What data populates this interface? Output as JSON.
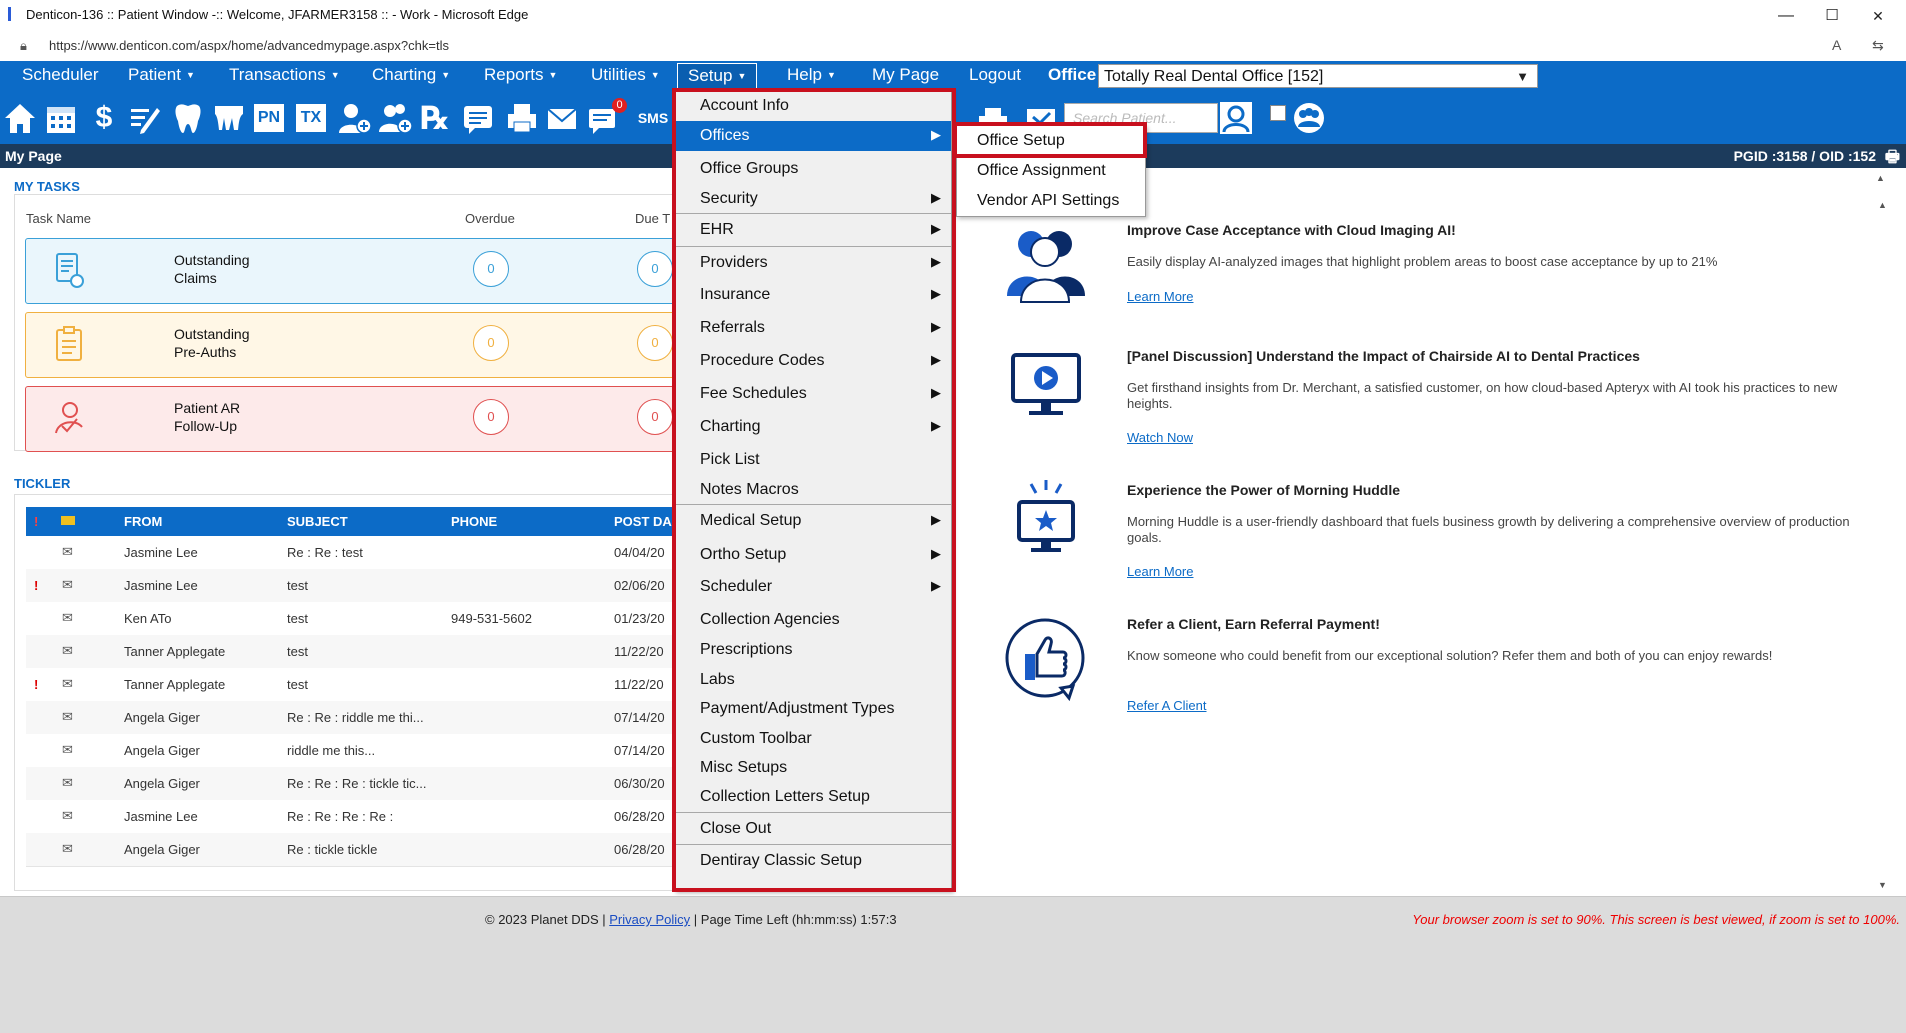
{
  "browser": {
    "title": "Denticon-136 :: Patient Window -:: Welcome, JFARMER3158 :: - Work - Microsoft Edge",
    "url": "https://www.denticon.com/aspx/home/advancedmypage.aspx?chk=tls",
    "minimize": "—",
    "maximize": "☐",
    "close": "✕"
  },
  "nav": {
    "items": [
      {
        "label": "Scheduler",
        "caret": ""
      },
      {
        "label": "Patient",
        "caret": "▼"
      },
      {
        "label": "Transactions",
        "caret": "▼"
      },
      {
        "label": "Charting",
        "caret": "▼"
      },
      {
        "label": "Reports",
        "caret": "▼"
      },
      {
        "label": "Utilities",
        "caret": "▼"
      },
      {
        "label": "Setup",
        "caret": "▼"
      },
      {
        "label": "Help",
        "caret": "▼"
      },
      {
        "label": "My Page",
        "caret": ""
      },
      {
        "label": "Logout",
        "caret": ""
      }
    ],
    "office_label": "Office",
    "office_value": "Totally Real Dental Office [152]"
  },
  "toolbar": {
    "pn": "PN",
    "tx": "TX",
    "rx": "℞",
    "sms": "SMS",
    "badge": "0",
    "search_placeholder": "Search Patient..."
  },
  "breadcrumb": {
    "title": "My Page",
    "ids": "PGID :3158  /  OID :152"
  },
  "tasks": {
    "header": "MY TASKS",
    "col_name": "Task Name",
    "col_overdue": "Overdue",
    "col_due": "Due T",
    "items": [
      {
        "line1": "Outstanding",
        "line2": "Claims",
        "overdue": "0",
        "due": "0",
        "color": "#3aa0d8",
        "bg": "#eaf6fc"
      },
      {
        "line1": "Outstanding",
        "line2": "Pre-Auths",
        "overdue": "0",
        "due": "0",
        "color": "#f0b040",
        "bg": "#fff7e6"
      },
      {
        "line1": "Patient AR",
        "line2": "Follow-Up",
        "overdue": "0",
        "due": "0",
        "color": "#e05050",
        "bg": "#fdeaea"
      }
    ]
  },
  "tickler": {
    "header": "TICKLER",
    "cols": {
      "flag": "!",
      "from": "FROM",
      "subject": "SUBJECT",
      "phone": "PHONE",
      "post": "POST DA"
    },
    "rows": [
      {
        "flag": "",
        "from": "Jasmine Lee",
        "subject": "Re : Re : test",
        "phone": "",
        "post": "04/04/20"
      },
      {
        "flag": "!",
        "from": "Jasmine Lee",
        "subject": "test",
        "phone": "",
        "post": "02/06/20"
      },
      {
        "flag": "",
        "from": "Ken ATo",
        "subject": "test",
        "phone": "949-531-5602",
        "post": "01/23/20"
      },
      {
        "flag": "",
        "from": "Tanner Applegate",
        "subject": "test",
        "phone": "",
        "post": "11/22/20"
      },
      {
        "flag": "!",
        "from": "Tanner Applegate",
        "subject": "test",
        "phone": "",
        "post": "11/22/20"
      },
      {
        "flag": "",
        "from": "Angela Giger",
        "subject": "Re : Re : riddle me thi...",
        "phone": "",
        "post": "07/14/20"
      },
      {
        "flag": "",
        "from": "Angela Giger",
        "subject": "riddle me this...",
        "phone": "",
        "post": "07/14/20"
      },
      {
        "flag": "",
        "from": "Angela Giger",
        "subject": "Re : Re : Re : tickle tic...",
        "phone": "",
        "post": "06/30/20"
      },
      {
        "flag": "",
        "from": "Jasmine Lee",
        "subject": "Re : Re : Re : Re :",
        "phone": "",
        "post": "06/28/20"
      },
      {
        "flag": "",
        "from": "Angela Giger",
        "subject": "Re : tickle tickle",
        "phone": "",
        "post": "06/28/20"
      }
    ]
  },
  "promos": [
    {
      "title": "Improve Case Acceptance with Cloud Imaging AI!",
      "desc": "Easily display AI-analyzed images that highlight problem areas to boost case acceptance by up to 21%",
      "link": "Learn More"
    },
    {
      "title": "[Panel Discussion] Understand the Impact of Chairside AI to Dental Practices",
      "desc": "Get firsthand insights from Dr. Merchant, a satisfied customer, on how cloud-based Apteryx with AI took his practices to new heights.",
      "link": "Watch Now"
    },
    {
      "title": "Experience the Power of Morning Huddle",
      "desc": "Morning Huddle is a user-friendly dashboard that fuels business growth by delivering a comprehensive overview of production goals.",
      "link": "Learn More"
    },
    {
      "title": "Refer a Client, Earn Referral Payment!",
      "desc": "Know someone who could benefit from our exceptional solution? Refer them and both of you can enjoy rewards!",
      "link": "Refer A Client"
    }
  ],
  "setup_menu": {
    "items": [
      {
        "label": "Account Info",
        "sub": false
      },
      {
        "label": "Offices",
        "sub": true
      },
      {
        "label": "Office Groups",
        "sub": false
      },
      {
        "label": "Security",
        "sub": true
      },
      {
        "label": "EHR",
        "sub": true
      },
      {
        "label": "Providers",
        "sub": true
      },
      {
        "label": "Insurance",
        "sub": true
      },
      {
        "label": "Referrals",
        "sub": true
      },
      {
        "label": "Procedure Codes",
        "sub": true
      },
      {
        "label": "Fee Schedules",
        "sub": true
      },
      {
        "label": "Charting",
        "sub": true
      },
      {
        "label": "Pick List",
        "sub": false
      },
      {
        "label": "Notes Macros",
        "sub": false
      },
      {
        "label": "Medical Setup",
        "sub": true
      },
      {
        "label": "Ortho Setup",
        "sub": true
      },
      {
        "label": "Scheduler",
        "sub": true
      },
      {
        "label": "Collection Agencies",
        "sub": false
      },
      {
        "label": "Prescriptions",
        "sub": false
      },
      {
        "label": "Labs",
        "sub": false
      },
      {
        "label": "Payment/Adjustment Types",
        "sub": false
      },
      {
        "label": "Custom Toolbar",
        "sub": false
      },
      {
        "label": "Misc Setups",
        "sub": false
      },
      {
        "label": "Collection Letters Setup",
        "sub": false
      },
      {
        "label": "Close Out",
        "sub": false
      },
      {
        "label": "Dentiray Classic Setup",
        "sub": false
      }
    ],
    "arrow": "▶"
  },
  "offices_submenu": {
    "items": [
      "Office Setup",
      "Office Assignment",
      "Vendor API Settings"
    ]
  },
  "footer": {
    "copyright": "© 2023 Planet DDS | ",
    "privacy": "Privacy Policy",
    "page_time": " |  Page Time Left (hh:mm:ss) 1:57:3",
    "warning": "Your browser zoom is set to 90%. This screen is best viewed, if zoom is set to 100%."
  },
  "colors": {
    "brand_blue": "#0c6bc7",
    "highlight_red": "#c8101e",
    "dark_navy": "#1c3b5c"
  },
  "icons": [
    "home-icon",
    "calendar-icon",
    "dollar-icon",
    "edit-icon",
    "tooth-icon",
    "teeth-icon",
    "pn-icon",
    "tx-icon",
    "add-user-icon",
    "add-group-icon",
    "rx-icon",
    "notes-icon",
    "print-icon",
    "mail-icon",
    "message-icon",
    "sms-icon",
    "patient-search-icon",
    "group-icon"
  ]
}
